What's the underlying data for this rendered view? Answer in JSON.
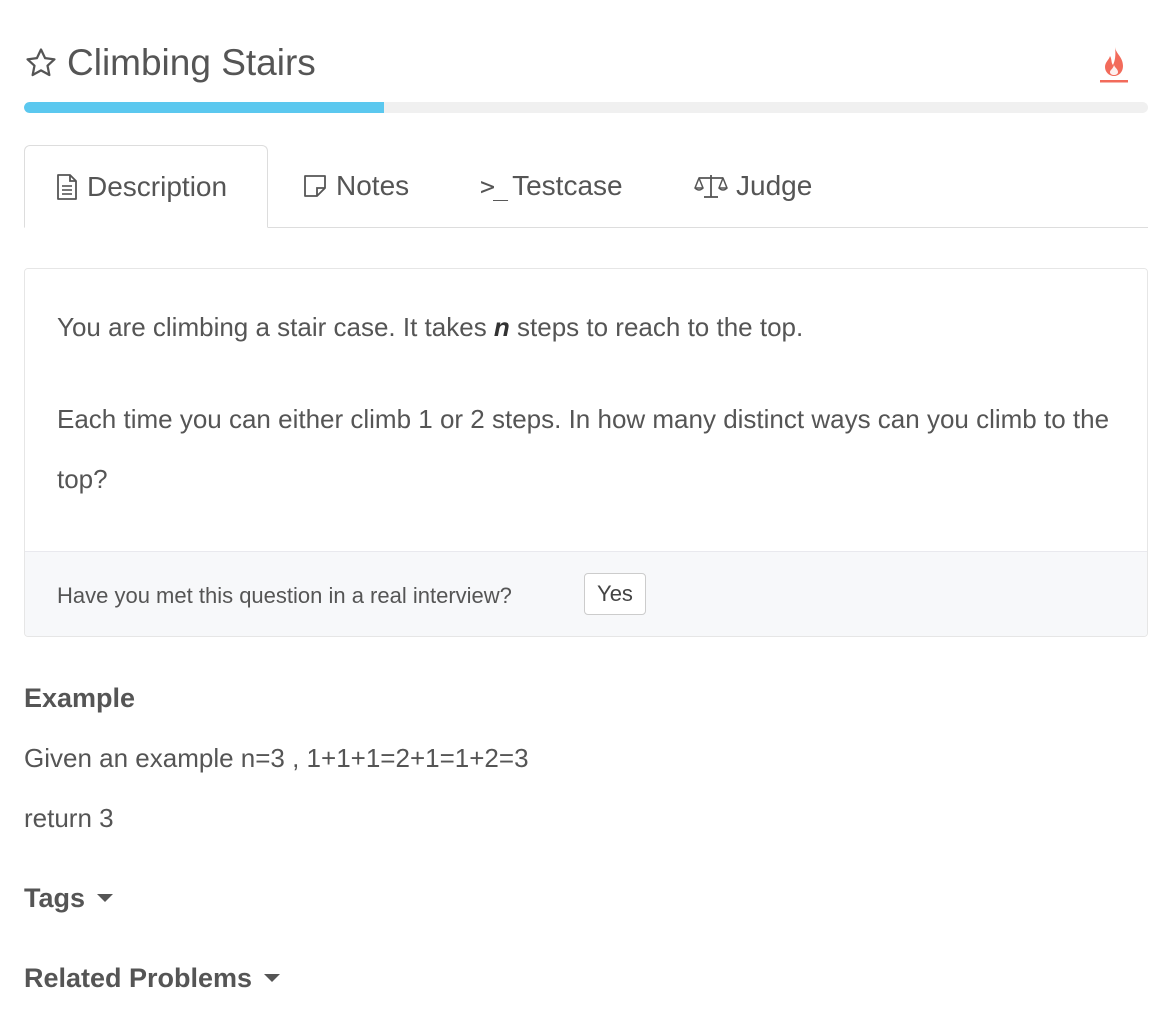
{
  "header": {
    "title": "Climbing Stairs",
    "star_icon": "star-outline-icon",
    "flame_icon": "flame-icon",
    "flame_color": "#f26b5b"
  },
  "progress": {
    "fraction": 0.32,
    "color": "#5bc8ef"
  },
  "tabs": [
    {
      "label": "Description",
      "icon": "document-icon",
      "active": true
    },
    {
      "label": "Notes",
      "icon": "note-icon",
      "active": false
    },
    {
      "label": "Testcase",
      "icon": "terminal-icon",
      "active": false
    },
    {
      "label": "Judge",
      "icon": "scale-icon",
      "active": false
    }
  ],
  "description": {
    "line1_before": "You are climbing a stair case. It takes ",
    "line1_var": "n",
    "line1_after": " steps to reach to the top.",
    "line2": "Each time you can either climb 1 or 2 steps. In how many distinct ways can you climb to the top?"
  },
  "interview": {
    "question": "Have you met this question in a real interview?",
    "yes_label": "Yes"
  },
  "example": {
    "heading": "Example",
    "line1": "Given an example n=3 , 1+1+1=2+1=1+2=3",
    "line2": "return 3"
  },
  "tags": {
    "heading": "Tags"
  },
  "related": {
    "heading": "Related Problems"
  }
}
